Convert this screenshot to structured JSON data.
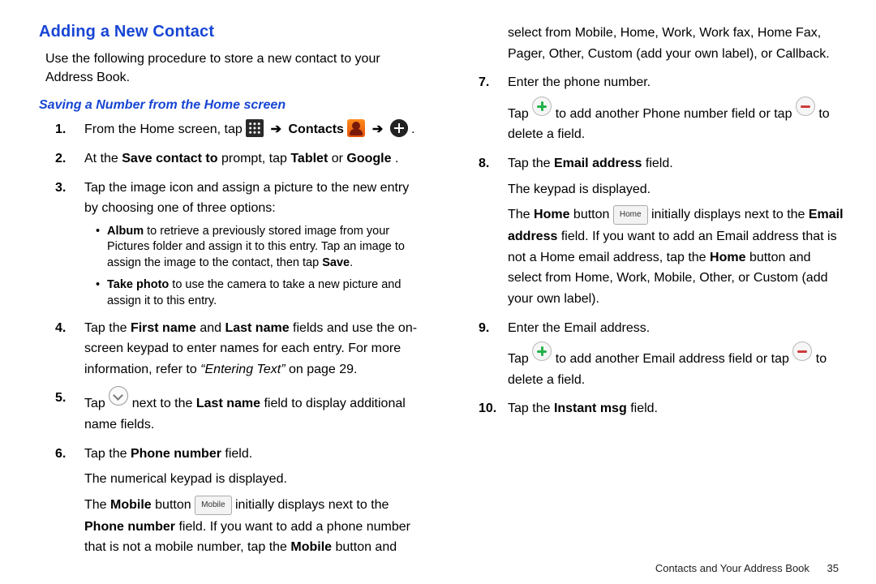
{
  "heading": "Adding a New Contact",
  "intro": "Use the following procedure to store a new contact to your Address Book.",
  "subheading": "Saving a Number from the Home screen",
  "arrow": "➔",
  "steps": {
    "s1": {
      "num": "1.",
      "t1": "From the Home screen, tap ",
      "contacts_label": "Contacts",
      "dot": " ."
    },
    "s2": {
      "num": "2.",
      "t1": "At the ",
      "b1": "Save contact to",
      "t2": " prompt, tap ",
      "b2": "Tablet",
      "t3": " or ",
      "b3": "Google",
      "t4": "."
    },
    "s3": {
      "num": "3.",
      "t1": "Tap the image icon and assign a picture to the new entry by choosing one of three options:",
      "bullets": {
        "a": {
          "b": "Album",
          "t": " to retrieve a previously stored image from your Pictures folder and assign it to this entry. Tap an image to assign the image to the contact, then tap ",
          "b2": "Save",
          "t2": "."
        },
        "b": {
          "b": "Take photo",
          "t": " to use the camera to take a new picture and assign it to this entry."
        }
      }
    },
    "s4": {
      "num": "4.",
      "t1": "Tap the ",
      "b1": "First name",
      "t2": " and ",
      "b2": "Last name",
      "t3": " fields and use the on-screen keypad to enter names for each entry. For more information, refer to ",
      "i1": "“Entering Text”",
      "t4": "  on page 29."
    },
    "s5": {
      "num": "5.",
      "t1": "Tap ",
      "t2": " next to the ",
      "b1": "Last name",
      "t3": " field to display additional name fields."
    },
    "s6": {
      "num": "6.",
      "t1": "Tap the ",
      "b1": "Phone number",
      "t2": " field.",
      "p2": "The numerical keypad is displayed."
    },
    "mobile_para": {
      "t1": "The ",
      "b1": "Mobile",
      "t2": " button ",
      "btn": "Mobile",
      "t3": " initially displays next to the ",
      "b2": "Phone number",
      "t4": " field. If you want to add a phone number that is not a mobile number, tap the ",
      "b3": "Mobile",
      "t5": " button and select from Mobile, Home, Work, Work fax, Home Fax, Pager, Other, Custom (add your own label), or Callback."
    },
    "s7": {
      "num": "7.",
      "t1": "Enter the phone number.",
      "p2a": "Tap ",
      "p2b": " to add another Phone number field or tap ",
      "p2c": " to delete a field."
    },
    "s8": {
      "num": "8.",
      "t1": "Tap the ",
      "b1": "Email address",
      "t2": " field.",
      "p2": "The keypad is displayed.",
      "p3_t1": "The ",
      "p3_b1": "Home",
      "p3_t2": " button ",
      "p3_btn": "Home",
      "p3_t3": " initially displays next to the ",
      "p3_b2": "Email address",
      "p3_t4": " field. If you want to add an Email address that is not a Home email address, tap the ",
      "p3_b3": "Home",
      "p3_t5": " button and select from Home, Work, Mobile, Other, or Custom (add your own label)."
    },
    "s9": {
      "num": "9.",
      "t1": "Enter the Email address.",
      "p2a": "Tap ",
      "p2b": " to add another Email address field or tap ",
      "p2c": " to delete a field."
    },
    "s10": {
      "num": "10.",
      "t1": "Tap the ",
      "b1": "Instant msg",
      "t2": " field."
    }
  },
  "footer": {
    "section": "Contacts and Your Address Book",
    "page": "35"
  }
}
